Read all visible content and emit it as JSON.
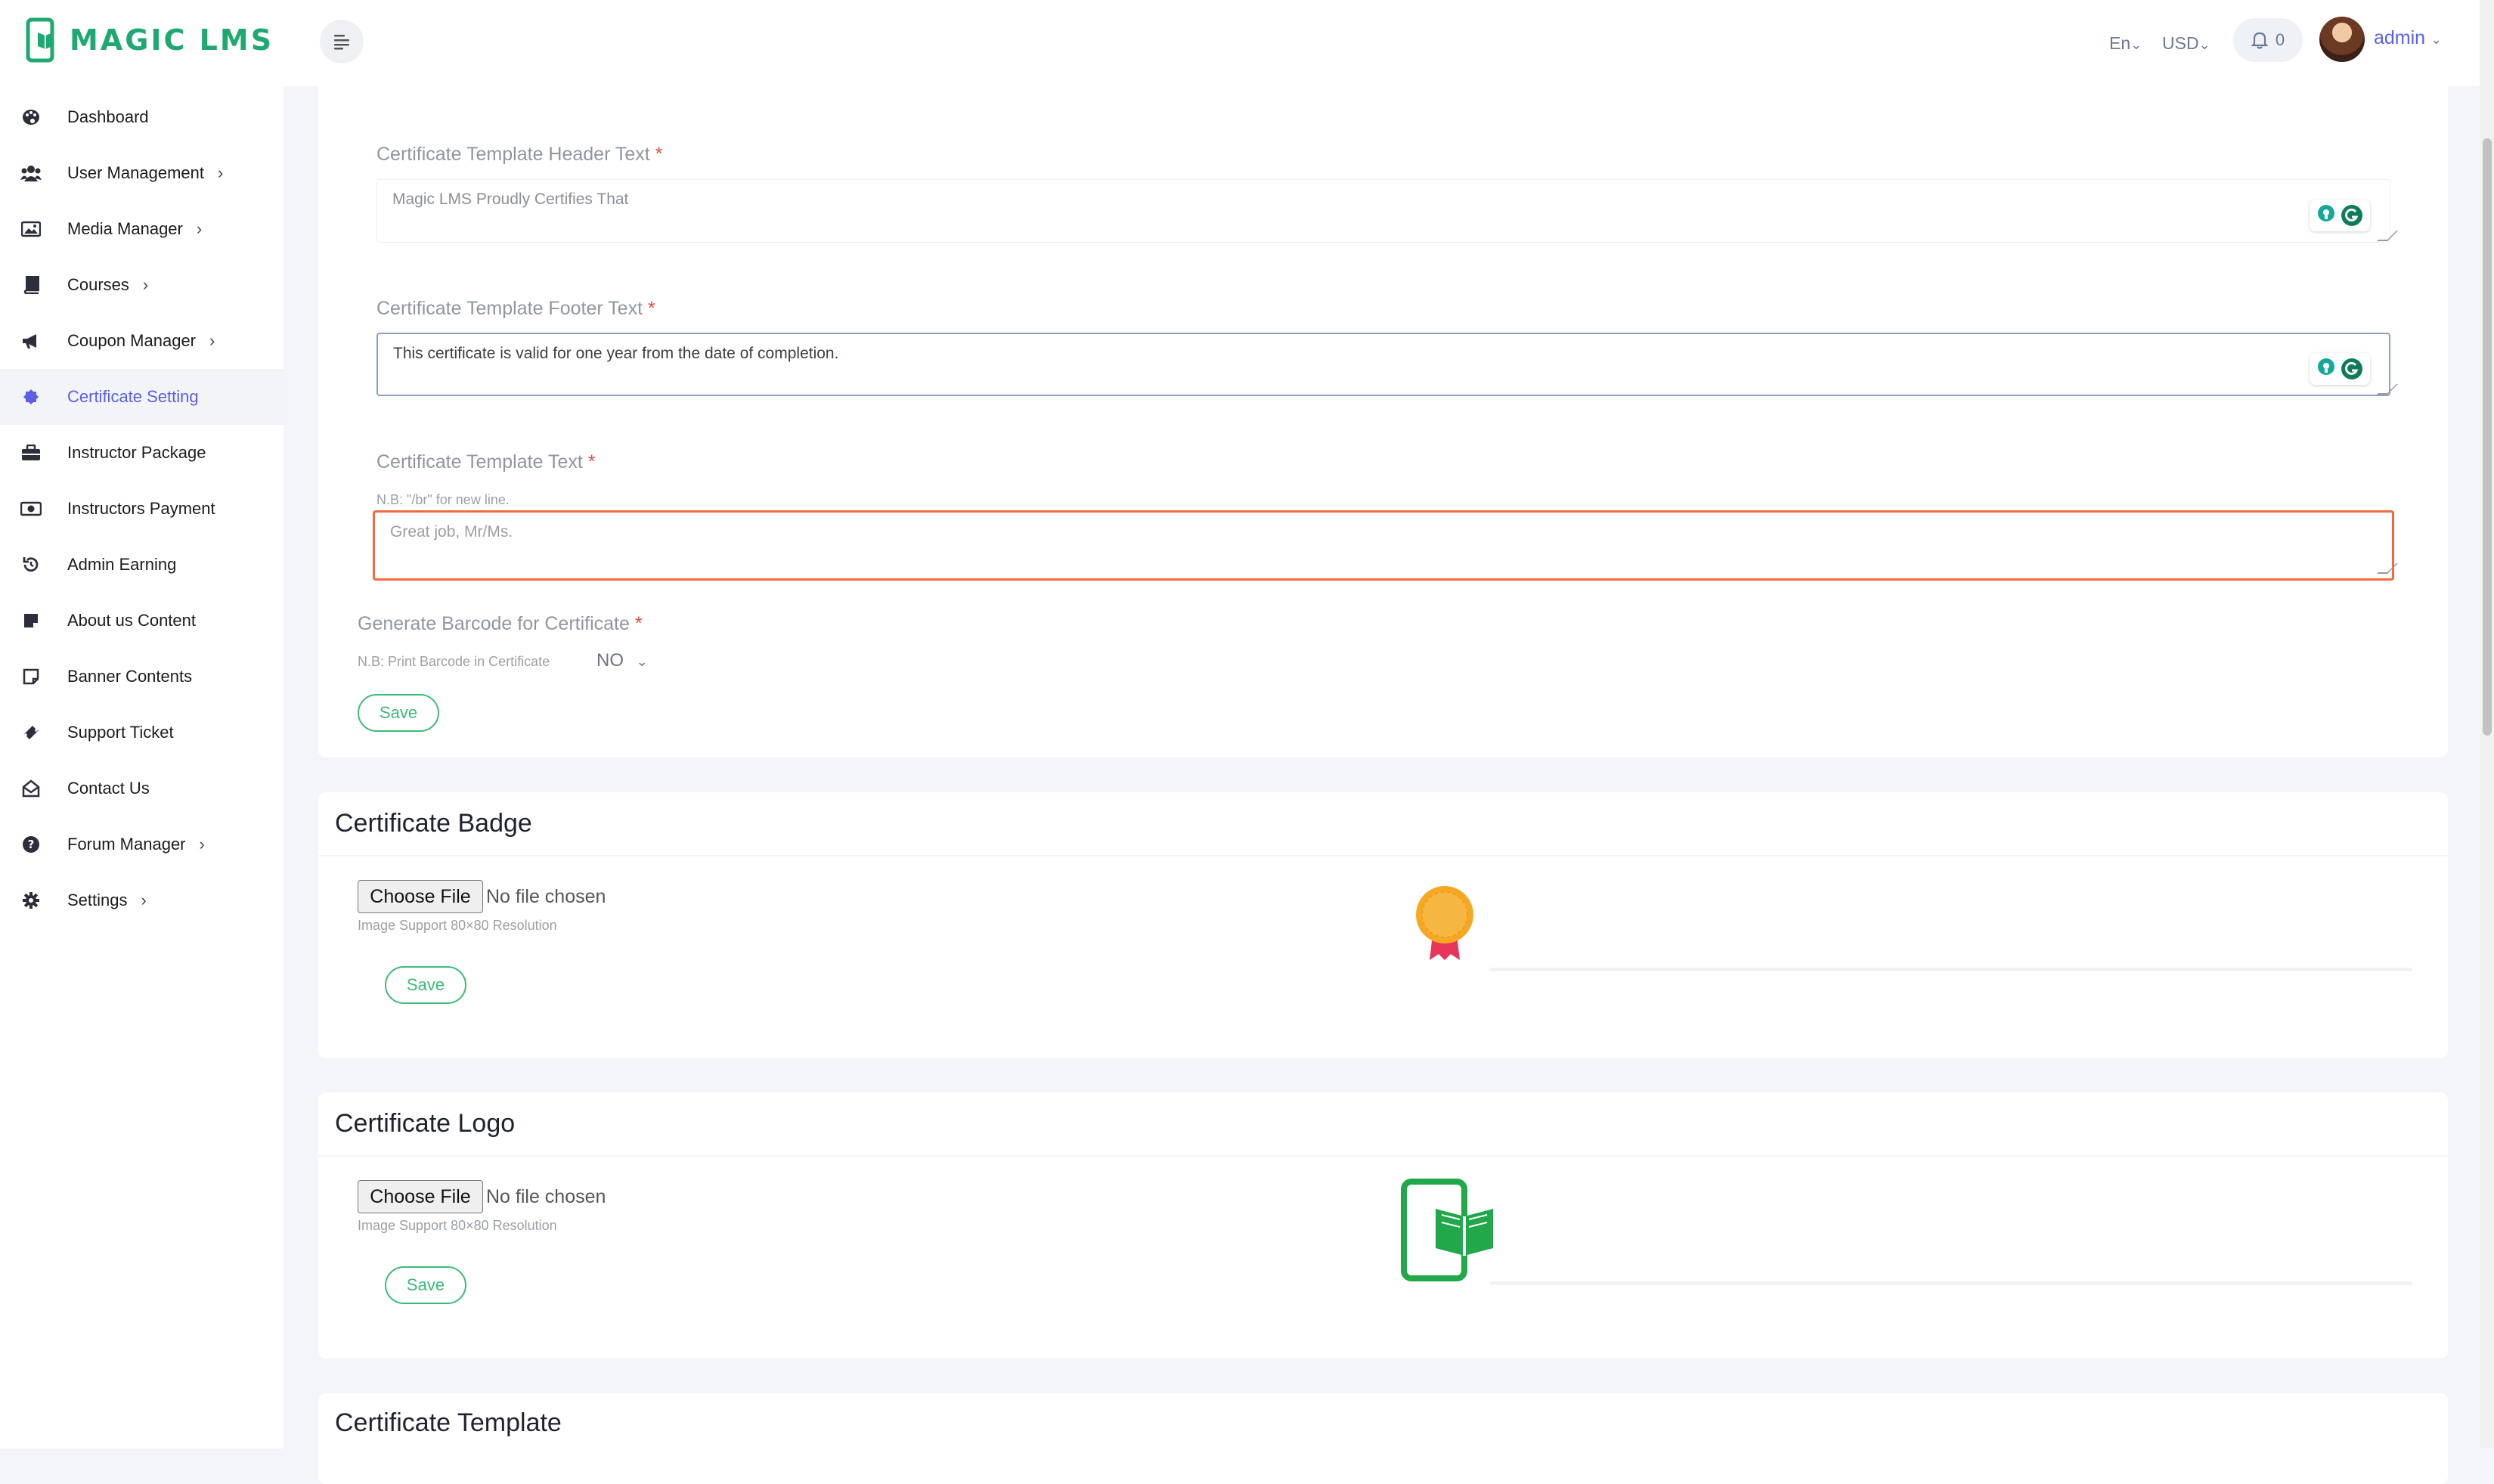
{
  "app": {
    "logo_text": "MAGIC LMS",
    "accent": "#1fa971",
    "active_color": "#5a60e6"
  },
  "sidebar": {
    "items": [
      {
        "label": "Dashboard",
        "icon": "palette-icon",
        "chevron": false,
        "active": false
      },
      {
        "label": "User Management",
        "icon": "users-icon",
        "chevron": true,
        "active": false
      },
      {
        "label": "Media Manager",
        "icon": "image-icon",
        "chevron": true,
        "active": false
      },
      {
        "label": "Courses",
        "icon": "book-icon",
        "chevron": true,
        "active": false
      },
      {
        "label": "Coupon Manager",
        "icon": "megaphone-icon",
        "chevron": true,
        "active": false
      },
      {
        "label": "Certificate Setting",
        "icon": "badge-icon",
        "chevron": false,
        "active": true
      },
      {
        "label": "Instructor Package",
        "icon": "briefcase-icon",
        "chevron": false,
        "active": false
      },
      {
        "label": "Instructors Payment",
        "icon": "money-icon",
        "chevron": false,
        "active": false
      },
      {
        "label": "Admin Earning",
        "icon": "history-icon",
        "chevron": false,
        "active": false
      },
      {
        "label": "About us Content",
        "icon": "note-icon",
        "chevron": false,
        "active": false
      },
      {
        "label": "Banner Contents",
        "icon": "sticky-note-icon",
        "chevron": false,
        "active": false
      },
      {
        "label": "Support Ticket",
        "icon": "ticket-icon",
        "chevron": false,
        "active": false
      },
      {
        "label": "Contact Us",
        "icon": "envelope-open-icon",
        "chevron": false,
        "active": false
      },
      {
        "label": "Forum Manager",
        "icon": "question-circle-icon",
        "chevron": true,
        "active": false
      },
      {
        "label": "Settings",
        "icon": "gear-icon",
        "chevron": true,
        "active": false
      }
    ]
  },
  "topbar": {
    "language": "En",
    "currency": "USD",
    "notification_count": "0",
    "user_name": "admin"
  },
  "form": {
    "header_label": "Certificate Template Header Text",
    "header_placeholder": "Magic LMS Proudly Certifies That",
    "footer_label": "Certificate Template Footer Text",
    "footer_value": "This certificate is valid for one year from the date of completion.",
    "text_label": "Certificate Template Text",
    "text_note": "N.B: \"/br\" for new line.",
    "text_placeholder": "Great job, Mr/Ms.",
    "barcode_label": "Generate Barcode for Certificate",
    "barcode_note": "N.B: Print Barcode in Certificate",
    "barcode_value": "NO",
    "required_mark": "*",
    "save_label": "Save"
  },
  "badge_section": {
    "title": "Certificate Badge",
    "choose_file": "Choose File",
    "no_file": "No file chosen",
    "note": "Image Support 80×80 Resolution",
    "save_label": "Save"
  },
  "logo_section": {
    "title": "Certificate Logo",
    "choose_file": "Choose File",
    "no_file": "No file chosen",
    "note": "Image Support 80×80 Resolution",
    "save_label": "Save"
  },
  "template_section": {
    "title": "Certificate Template"
  }
}
